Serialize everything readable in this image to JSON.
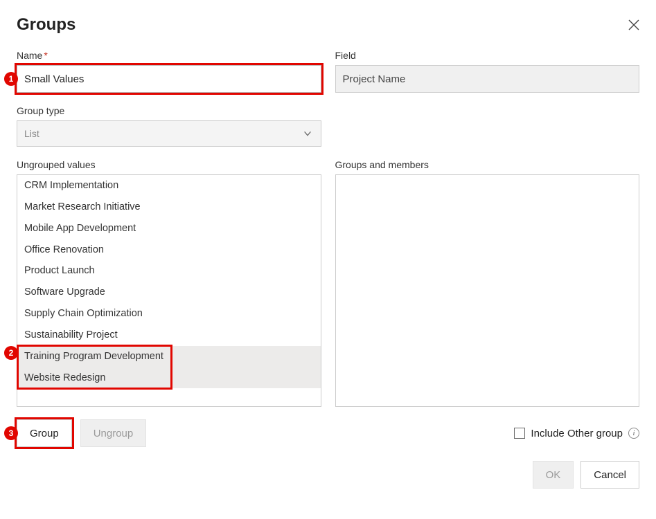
{
  "header": {
    "title": "Groups"
  },
  "form": {
    "name_label": "Name",
    "name_value": "Small Values",
    "field_label": "Field",
    "field_value": "Project Name",
    "grouptype_label": "Group type",
    "grouptype_value": "List",
    "ungrouped_label": "Ungrouped values",
    "members_label": "Groups and members"
  },
  "ungrouped_values": [
    {
      "label": "CRM Implementation",
      "selected": false
    },
    {
      "label": "Market Research Initiative",
      "selected": false
    },
    {
      "label": "Mobile App Development",
      "selected": false
    },
    {
      "label": "Office Renovation",
      "selected": false
    },
    {
      "label": "Product Launch",
      "selected": false
    },
    {
      "label": "Software Upgrade",
      "selected": false
    },
    {
      "label": "Supply Chain Optimization",
      "selected": false
    },
    {
      "label": "Sustainability Project",
      "selected": false
    },
    {
      "label": "Training Program Development",
      "selected": true
    },
    {
      "label": "Website Redesign",
      "selected": true
    }
  ],
  "buttons": {
    "group": "Group",
    "ungroup": "Ungroup",
    "include_other": "Include Other group",
    "ok": "OK",
    "cancel": "Cancel"
  },
  "callouts": {
    "c1": "1",
    "c2": "2",
    "c3": "3"
  }
}
